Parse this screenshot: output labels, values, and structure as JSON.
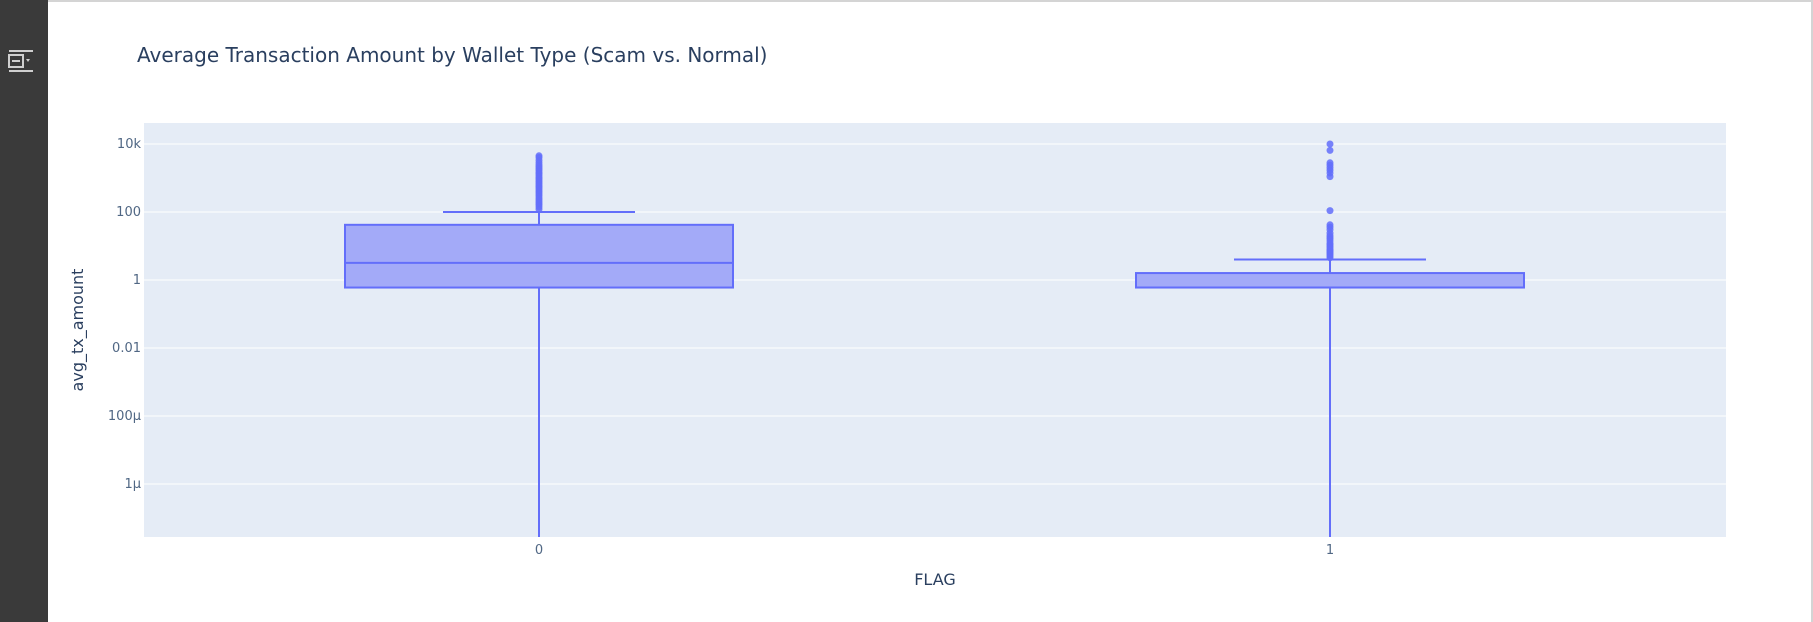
{
  "sidebar": {
    "toggle_icon": "sidebar-toggle-icon"
  },
  "chart_data": {
    "type": "box",
    "title": "Average Transaction Amount by Wallet Type (Scam vs. Normal)",
    "xlabel": "FLAG",
    "ylabel": "avg_tx_amount",
    "yscale": "log",
    "yrange": [
      2e-08,
      40000
    ],
    "categories": [
      "0",
      "1"
    ],
    "ytick_values": [
      10000,
      100,
      1,
      0.01,
      0.0001,
      1e-06
    ],
    "ytick_labels": [
      "10k",
      "100",
      "1",
      "0.01",
      "100μ",
      "1μ"
    ],
    "grid": true,
    "colors": {
      "plot_bg": "#e5ecf6",
      "box_line": "#636efa",
      "box_fill": "#a3aaf8",
      "text": "#2a3f5f",
      "tick_text": "#506784"
    },
    "boxes": [
      {
        "name": "0",
        "min": 2e-08,
        "q1": 0.6,
        "median": 3.2,
        "q3": 42,
        "upper_fence": 100,
        "outliers": [
          120,
          140,
          160,
          180,
          200,
          230,
          260,
          300,
          340,
          380,
          430,
          480,
          540,
          600,
          680,
          760,
          850,
          950,
          1050,
          1200,
          1350,
          1500,
          1700,
          1900,
          2100,
          2400,
          2800,
          3300,
          4000,
          4500
        ]
      },
      {
        "name": "1",
        "min": 2e-08,
        "q1": 0.6,
        "median": 0.6,
        "q3": 1.6,
        "upper_fence": 4,
        "outliers": [
          4.5,
          5,
          5.5,
          6,
          6.5,
          7,
          7.5,
          8,
          9,
          10,
          11,
          12,
          14,
          16,
          18,
          20,
          24,
          30,
          36,
          42,
          110,
          1100,
          1400,
          1700,
          2000,
          2400,
          2800,
          6500,
          10000
        ]
      }
    ]
  }
}
